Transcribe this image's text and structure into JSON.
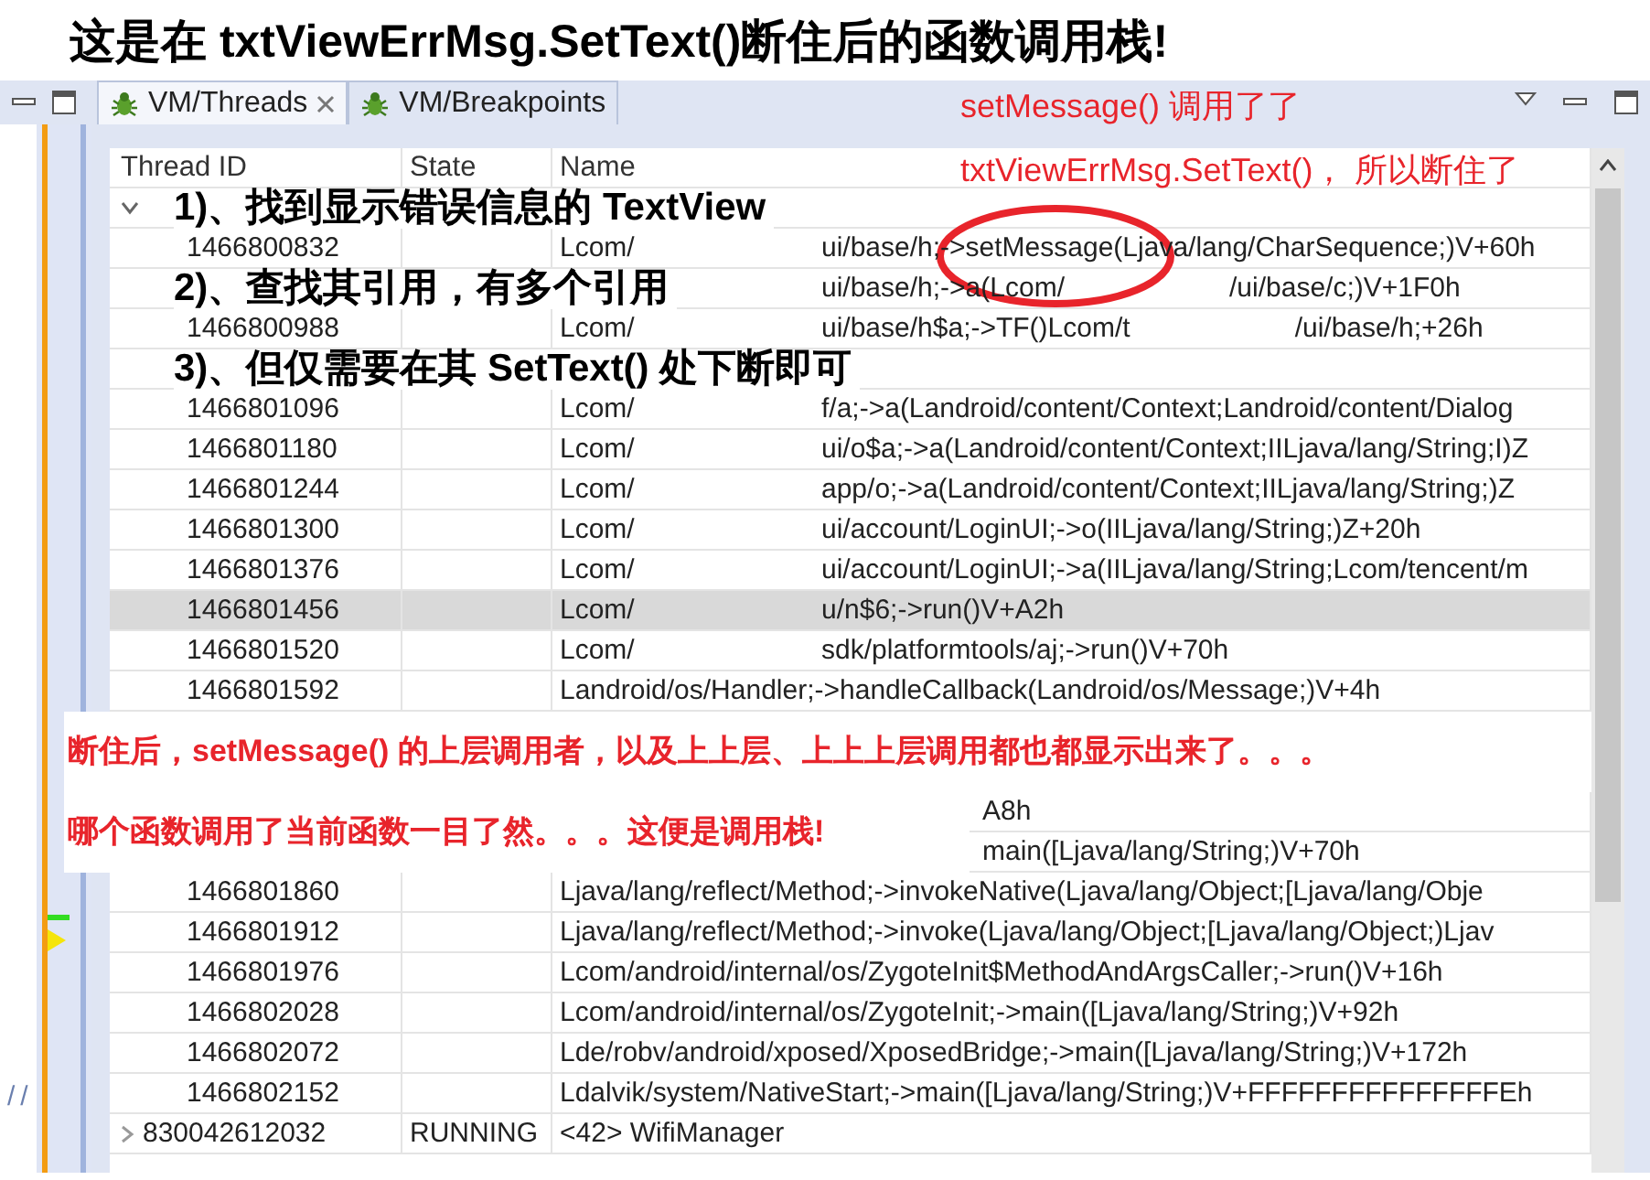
{
  "title": "这是在 txtViewErrMsg.SetText()断住后的函数调用栈!",
  "left_panel": {
    "text": "//"
  },
  "tabs": [
    {
      "label": "VM/Threads",
      "selected": true,
      "closable": true
    },
    {
      "label": "VM/Breakpoints",
      "selected": false,
      "closable": false
    }
  ],
  "table": {
    "columns": [
      "Thread ID",
      "State",
      "Name"
    ],
    "rows": [
      {
        "kind": "thread",
        "expanded": true,
        "selected": false
      },
      {
        "kind": "frame",
        "id": "1466800832",
        "name": "Lcom/",
        "method": "ui/base/h;->setMessage(Ljava/lang/CharSequence;)V+60h",
        "selected": false
      },
      {
        "kind": "covered",
        "method": "ui/base/h;->a(Lcom/",
        "method_tail": "/ui/base/c;)V+1F0h",
        "selected": false
      },
      {
        "kind": "frame",
        "id": "1466800988",
        "name": "Lcom/",
        "method": "ui/base/h$a;->TF()Lcom/t",
        "method_tail": "/ui/base/h;+26h",
        "selected": false
      },
      {
        "kind": "blank"
      },
      {
        "kind": "frame",
        "id": "1466801096",
        "name": "Lcom/",
        "method": "f/a;->a(Landroid/content/Context;Landroid/content/Dialog",
        "selected": false
      },
      {
        "kind": "frame",
        "id": "1466801180",
        "name": "Lcom/",
        "method": "ui/o$a;->a(Landroid/content/Context;IILjava/lang/String;I)Z",
        "selected": false
      },
      {
        "kind": "frame",
        "id": "1466801244",
        "name": "Lcom/",
        "method": "app/o;->a(Landroid/content/Context;IILjava/lang/String;)Z",
        "selected": false
      },
      {
        "kind": "frame",
        "id": "1466801300",
        "name": "Lcom/",
        "method": "ui/account/LoginUI;->o(IILjava/lang/String;)Z+20h",
        "selected": false
      },
      {
        "kind": "frame",
        "id": "1466801376",
        "name": "Lcom/",
        "method": "ui/account/LoginUI;->a(IILjava/lang/String;Lcom/tencent/m",
        "selected": false
      },
      {
        "kind": "frame",
        "id": "1466801456",
        "name": "Lcom/",
        "method": "u/n$6;->run()V+A2h",
        "selected": true
      },
      {
        "kind": "frame",
        "id": "1466801520",
        "name": "Lcom/",
        "method": "sdk/platformtools/aj;->run()V+70h",
        "selected": false
      },
      {
        "kind": "frame",
        "id": "1466801592",
        "name": "Landroid/os/Handler;->handleCallback(Landroid/os/Message;)V+4h",
        "selected": false
      },
      {
        "kind": "blank"
      },
      {
        "kind": "blank"
      },
      {
        "kind": "tail",
        "method": "A8h"
      },
      {
        "kind": "tail",
        "method": "main([Ljava/lang/String;)V+70h"
      },
      {
        "kind": "frame",
        "id": "1466801860",
        "name": "Ljava/lang/reflect/Method;->invokeNative(Ljava/lang/Object;[Ljava/lang/Obje",
        "selected": false
      },
      {
        "kind": "frame",
        "id": "1466801912",
        "name": "Ljava/lang/reflect/Method;->invoke(Ljava/lang/Object;[Ljava/lang/Object;)Ljav",
        "selected": false
      },
      {
        "kind": "frame",
        "id": "1466801976",
        "name": "Lcom/android/internal/os/ZygoteInit$MethodAndArgsCaller;->run()V+16h",
        "selected": false
      },
      {
        "kind": "frame",
        "id": "1466802028",
        "name": "Lcom/android/internal/os/ZygoteInit;->main([Ljava/lang/String;)V+92h",
        "selected": false
      },
      {
        "kind": "frame",
        "id": "1466802072",
        "name": "Lde/robv/android/xposed/XposedBridge;->main([Ljava/lang/String;)V+172h",
        "selected": false
      },
      {
        "kind": "frame",
        "id": "1466802152",
        "name": "Ldalvik/system/NativeStart;->main([Ljava/lang/String;)V+FFFFFFFFFFFFFFFEh",
        "selected": false
      },
      {
        "kind": "thread",
        "expanded": false,
        "id": "830042612032",
        "state": "RUNNING",
        "name": "<42> WifiManager",
        "selected": false
      }
    ]
  },
  "annotations": [
    {
      "kind": "note",
      "text": "setMessage() 调用了了"
    },
    {
      "kind": "note",
      "text": "txtViewErrMsg.SetText()， 所以断住了"
    },
    {
      "kind": "step",
      "text": "1)、找到显示错误信息的 TextView"
    },
    {
      "kind": "step",
      "text": "2)、查找其引用，有多个引用"
    },
    {
      "kind": "step",
      "text": "3)、但仅需要在其 SetText() 处下断即可"
    },
    {
      "kind": "circle"
    },
    {
      "kind": "summary",
      "text": "断住后，setMessage() 的上层调用者，以及上上层、上上上层调用都也都显示出来了。。。"
    },
    {
      "kind": "summary",
      "text": "哪个函数调用了当前函数一目了然。。。这便是调用栈!"
    }
  ]
}
